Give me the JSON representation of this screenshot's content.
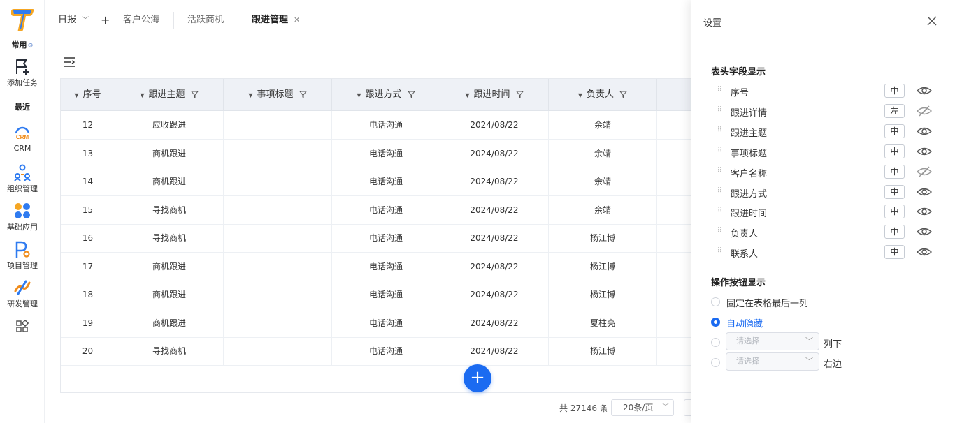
{
  "rail": {
    "section_common": "常用",
    "add_task": "添加任务",
    "section_recent": "最近",
    "crm_badge": "CRM",
    "crm": "CRM",
    "org": "组织管理",
    "basic": "基础应用",
    "project": "项目管理",
    "dev": "研发管理"
  },
  "topbar": {
    "tabs": [
      {
        "label": "日报"
      },
      {
        "label": "客户公海"
      },
      {
        "label": "活跃商机"
      },
      {
        "label": "跟进管理"
      }
    ],
    "add_label": "+"
  },
  "table": {
    "headers": [
      "序号",
      "跟进主题",
      "事项标题",
      "跟进方式",
      "跟进时间",
      "负责人"
    ],
    "rows": [
      [
        "12",
        "应收跟进",
        "",
        "电话沟通",
        "2024/08/22",
        "余靖"
      ],
      [
        "13",
        "商机跟进",
        "",
        "电话沟通",
        "2024/08/22",
        "余靖"
      ],
      [
        "14",
        "商机跟进",
        "",
        "电话沟通",
        "2024/08/22",
        "余靖"
      ],
      [
        "15",
        "寻找商机",
        "",
        "电话沟通",
        "2024/08/22",
        "余靖"
      ],
      [
        "16",
        "寻找商机",
        "",
        "电话沟通",
        "2024/08/22",
        "杨江博"
      ],
      [
        "17",
        "商机跟进",
        "",
        "电话沟通",
        "2024/08/22",
        "杨江博"
      ],
      [
        "18",
        "商机跟进",
        "",
        "电话沟通",
        "2024/08/22",
        "杨江博"
      ],
      [
        "19",
        "商机跟进",
        "",
        "电话沟通",
        "2024/08/22",
        "夏柱亮"
      ],
      [
        "20",
        "寻找商机",
        "",
        "电话沟通",
        "2024/08/22",
        "杨江博"
      ]
    ]
  },
  "fab_label": "+",
  "pager": {
    "total": "共 27146 条",
    "page_size": "20条/页"
  },
  "panel": {
    "title": "设置",
    "header_section": "表头字段显示",
    "fields": [
      {
        "label": "序号",
        "align": "中",
        "visible": true
      },
      {
        "label": "跟进详情",
        "align": "左",
        "visible": false
      },
      {
        "label": "跟进主题",
        "align": "中",
        "visible": true
      },
      {
        "label": "事项标题",
        "align": "中",
        "visible": true
      },
      {
        "label": "客户名称",
        "align": "中",
        "visible": false
      },
      {
        "label": "跟进方式",
        "align": "中",
        "visible": true
      },
      {
        "label": "跟进时间",
        "align": "中",
        "visible": true
      },
      {
        "label": "负责人",
        "align": "中",
        "visible": true
      },
      {
        "label": "联系人",
        "align": "中",
        "visible": true
      }
    ],
    "action_section": "操作按钮显示",
    "options": {
      "fixed_last": "固定在表格最后一列",
      "auto_hide": "自动隐藏",
      "select_placeholder": "请选择",
      "below_suffix": "列下",
      "right_suffix": "右边"
    }
  },
  "colors": {
    "accent": "#1b6bf1"
  }
}
